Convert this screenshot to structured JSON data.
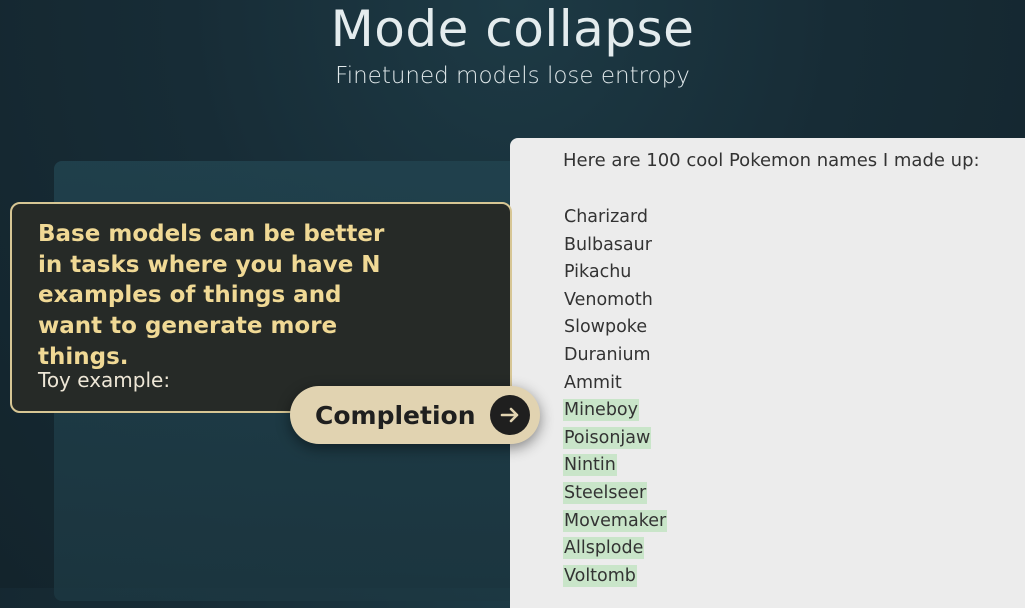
{
  "slide": {
    "title": "Mode collapse",
    "subtitle": "Finetuned models lose entropy"
  },
  "callout": {
    "body": "Base models can be better in tasks where you have N examples of things and want to generate more things.",
    "toy_label": "Toy example:"
  },
  "completion_button": {
    "label": "Completion",
    "icon": "arrow-right-icon"
  },
  "document": {
    "header": "Here are 100 cool Pokemon names I made up:",
    "prompt_names": [
      "Charizard",
      "Bulbasaur",
      "Pikachu",
      "Venomoth",
      "Slowpoke",
      "Duranium",
      "Ammit"
    ],
    "generated_names": [
      "Mineboy",
      "Poisonjaw",
      "Nintin",
      "Steelseer",
      "Movemaker",
      "Allsplode",
      "Voltomb"
    ]
  },
  "colors": {
    "background": "#172c36",
    "callout_text": "#f0d995",
    "callout_border": "#d7c694",
    "button_fill": "#e1d3b1",
    "generated_highlight": "#c9e5c9"
  }
}
